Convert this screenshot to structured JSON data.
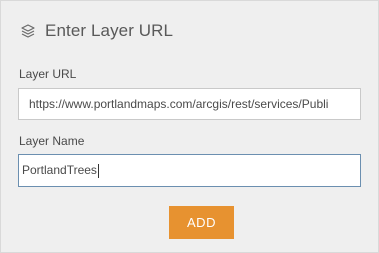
{
  "header": {
    "icon": "layers-icon",
    "title": "Enter Layer URL"
  },
  "form": {
    "url_label": "Layer URL",
    "url_value": "https://www.portlandmaps.com/arcgis/rest/services/Publi",
    "name_label": "Layer Name",
    "name_value": "PortlandTrees"
  },
  "actions": {
    "add_label": "ADD"
  },
  "colors": {
    "panel_bg": "#efefef",
    "accent": "#e79230",
    "focus_border": "#6b8fb0"
  }
}
